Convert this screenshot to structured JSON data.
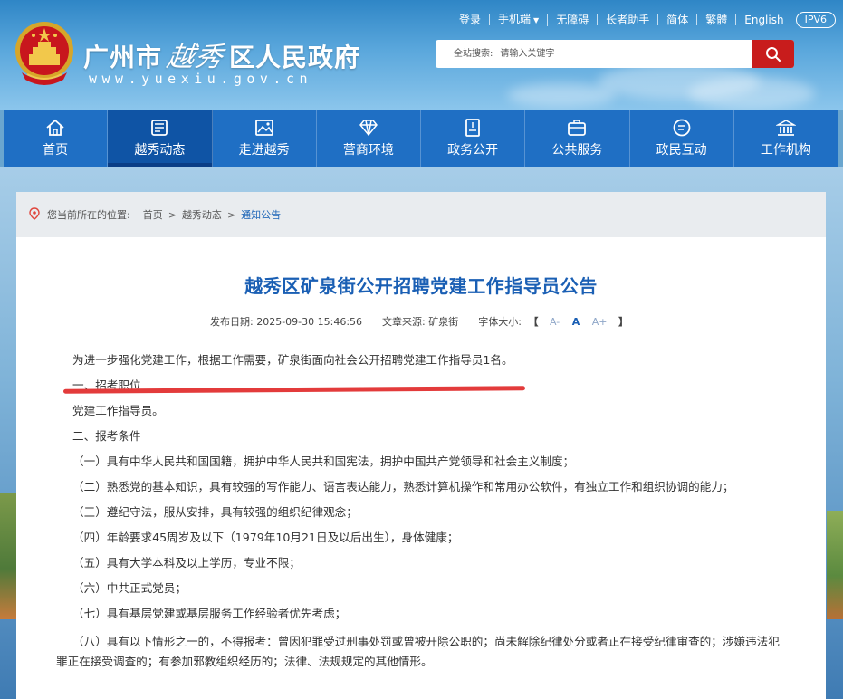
{
  "header": {
    "site_name_left": "广州市",
    "site_name_script": "越秀",
    "site_name_right": "区人民政府",
    "site_url": "www.yuexiu.gov.cn",
    "top_links": [
      "登录",
      "手机端",
      "无障碍",
      "长者助手",
      "简体",
      "繁體",
      "English"
    ],
    "ipv6_badge": "IPV6",
    "search": {
      "label": "全站搜索:",
      "placeholder": "请输入关键字"
    },
    "colors": {
      "nav": "#1f6fc4",
      "search_button": "#c81c1c"
    }
  },
  "nav": {
    "items": [
      {
        "label": "首页",
        "icon": "home-icon"
      },
      {
        "label": "越秀动态",
        "icon": "newspaper-icon",
        "active": true
      },
      {
        "label": "走进越秀",
        "icon": "landscape-icon"
      },
      {
        "label": "营商环境",
        "icon": "diamond-icon"
      },
      {
        "label": "政务公开",
        "icon": "document-icon"
      },
      {
        "label": "公共服务",
        "icon": "briefcase-icon"
      },
      {
        "label": "政民互动",
        "icon": "chat-icon"
      },
      {
        "label": "工作机构",
        "icon": "building-icon"
      }
    ]
  },
  "breadcrumb": {
    "prefix": "您当前所在的位置:",
    "items": [
      "首页",
      "越秀动态",
      "通知公告"
    ]
  },
  "article": {
    "title": "越秀区矿泉街公开招聘党建工作指导员公告",
    "publish_label": "发布日期:",
    "publish_date": "2025-09-30 15:46:56",
    "source_label": "文章来源:",
    "source": "矿泉街",
    "font_size_label": "字体大小:",
    "font_sizes": [
      "A-",
      "A",
      "A+"
    ],
    "paragraphs": [
      "为进一步强化党建工作，根据工作需要，矿泉街面向社会公开招聘党建工作指导员1名。",
      "一、招考职位",
      "党建工作指导员。",
      "二、报考条件",
      "（一）具有中华人民共和国国籍，拥护中华人民共和国宪法，拥护中国共产党领导和社会主义制度；",
      "（二）熟悉党的基本知识，具有较强的写作能力、语言表达能力，熟悉计算机操作和常用办公软件，有独立工作和组织协调的能力；",
      "（三）遵纪守法，服从安排，具有较强的组织纪律观念；",
      "（四）年龄要求45周岁及以下（1979年10月21日及以后出生），身体健康；",
      "（五）具有大学本科及以上学历，专业不限；",
      "（六）中共正式党员；",
      "（七）具有基层党建或基层服务工作经验者优先考虑；",
      "（八）具有以下情形之一的，不得报考：曾因犯罪受过刑事处罚或曾被开除公职的；尚未解除纪律处分或者正在接受纪律审查的；涉嫌违法犯罪正在接受调查的；有参加邪教组织经历的；法律、法规规定的其他情形。"
    ]
  }
}
